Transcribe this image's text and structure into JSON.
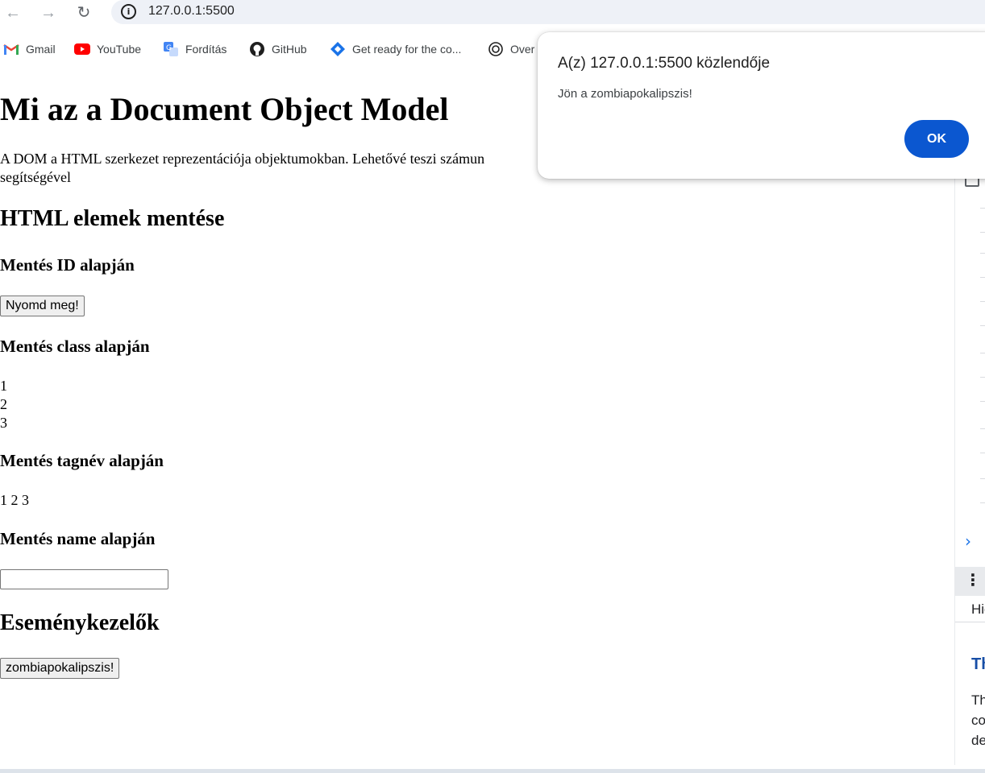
{
  "browser": {
    "url": "127.0.0.1:5500",
    "bookmarks": [
      {
        "label": "Gmail",
        "icon": "gmail-icon"
      },
      {
        "label": "YouTube",
        "icon": "youtube-icon"
      },
      {
        "label": "Fordítás",
        "icon": "translate-icon"
      },
      {
        "label": "GitHub",
        "icon": "github-icon"
      },
      {
        "label": "Get ready for the co...",
        "icon": "diamond-icon"
      },
      {
        "label": "Over",
        "icon": "openai-icon"
      }
    ]
  },
  "page": {
    "title": "Mi az a Document Object Model",
    "intro": "A DOM a HTML szerkezet reprezentációja objektumokban. Lehetővé teszi számun",
    "intro_line2": "segítségével",
    "section_save": "HTML elemek mentése",
    "by_id": "Mentés ID alapján",
    "button_press": "Nyomd meg!",
    "by_class": "Mentés class alapján",
    "class_items": [
      "1",
      "2",
      "3"
    ],
    "by_tag": "Mentés tagnév alapján",
    "tag_items": "1 2 3",
    "by_name": "Mentés name alapján",
    "name_input_value": "",
    "section_events": "Eseménykezelők",
    "button_zombie": "zombiapokalipszis!"
  },
  "alert": {
    "title": "A(z) 127.0.0.1:5500 közlendője",
    "message": "Jön a zombiapokalipszis!",
    "ok_label": "OK"
  },
  "side_panel": {
    "hig_text": "Hig",
    "th_heading": "Th",
    "text_lines": [
      "Th",
      "co",
      "de"
    ]
  },
  "colors": {
    "accent": "#0b57d0",
    "omnibox_bg": "#eef1f7"
  }
}
